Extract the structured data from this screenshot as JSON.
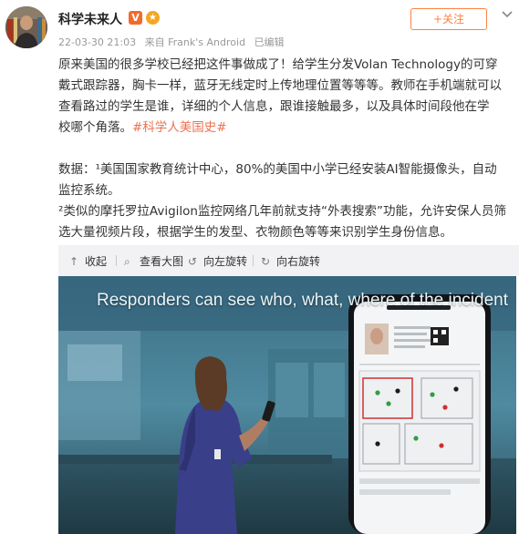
{
  "post": {
    "username": "科学未来人",
    "verified_badge": "V",
    "timestamp": "22-03-30 21:03",
    "source": "来自 Frank's Android",
    "edited": "已编辑",
    "follow_label": "+关注",
    "text_lines": [
      "原来美国的很多学校已经把这件事做成了！给学生分发Volan Technology的可穿",
      "戴式跟踪器，胸卡一样，蓝牙无线定时上传地理位置等等等。教师在手机端就可以",
      "查看路过的学生是谁，详细的个人信息，跟谁接触最多，以及具体时间段他在学",
      "校哪个角落。"
    ],
    "hashtag": "#科学人美国史#",
    "data_lines": [
      "数据：¹美国国家教育统计中心，80%的美国中小学已经安装AI智能摄像头，自动",
      "监控系统。",
      "²类似的摩托罗拉Avigilon监控网络几年前就支持“外表搜索”功能，允许安保人员筛",
      "选大量视频片段，根据学生的发型、衣物颜色等等来识别学生身份信息。"
    ]
  },
  "toolbar": {
    "collapse_label": "收起",
    "view_large_label": "查看大图",
    "rotate_left_label": "向左旋转",
    "rotate_right_label": "向右旋转"
  },
  "media": {
    "caption": "Responders can see who, what, where of the incident"
  },
  "colors": {
    "accent": "#ff8140",
    "hashtag": "#eb7350",
    "meta": "#999999"
  }
}
